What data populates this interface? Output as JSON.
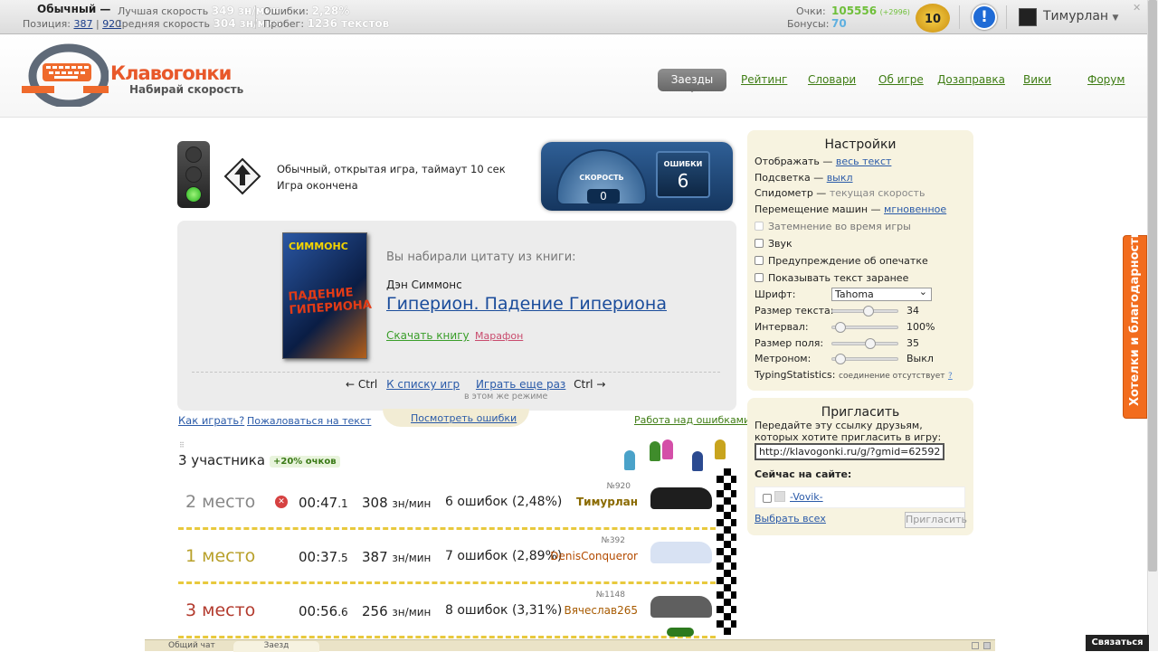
{
  "topbar": {
    "mode": "Обычный —",
    "position_label": "Позиция:",
    "position_a": "387",
    "position_sep": "|",
    "position_b": "920",
    "best_speed_label": "Лучшая скорость",
    "best_speed": "349 зн/мин",
    "avg_speed_label": "Средняя скорость",
    "avg_speed": "304 зн/мин",
    "errors_label": "Ошибки:",
    "errors": "2,28%",
    "mileage_label": "Пробег:",
    "mileage": "1236 текстов",
    "points_label": "Очки:",
    "points": "105556",
    "points_delta": "(+2996)",
    "bonus_label": "Бонусы:",
    "bonus": "70",
    "level": "10",
    "notif": "!",
    "username": "Тимурлан",
    "close": "✕"
  },
  "header": {
    "brand": "Клавогонки",
    "slogan": "Набирай скорость",
    "nav": [
      {
        "label": "Заезды"
      },
      {
        "label": "Рейтинг"
      },
      {
        "label": "Словари"
      },
      {
        "label": "Об игре"
      },
      {
        "label": "Дозаправка"
      },
      {
        "label": "Вики"
      },
      {
        "label": "Форум"
      }
    ]
  },
  "game": {
    "type_line": "Обычный, открытая игра, таймаут 10 сек",
    "status_line": "Игра окончена",
    "speed_label": "СКОРОСТЬ",
    "speed_value": "0",
    "errors_label": "ОШИБКИ",
    "errors_value": "6"
  },
  "book": {
    "cover_author": "СИММОНС",
    "cover_title": "ПАДЕНИЕ ГИПЕРИОНА",
    "label": "Вы набирали цитату из книги:",
    "author": "Дэн Симмонс",
    "title": "Гиперион. Падение Гипериона",
    "download": "Скачать книгу",
    "marathon": "Марафон",
    "ctrl_left": "← Ctrl",
    "to_list": "К списку игр",
    "play_again": "Играть еще раз",
    "play_again_sub": "в этом же режиме",
    "ctrl_right": "Ctrl →"
  },
  "links": {
    "how_to_play": "Как играть?",
    "complain": "Пожаловаться на текст",
    "view_errors": "Посмотреть ошибки",
    "work_errors": "Работа над ошибками"
  },
  "race": {
    "participants": "3 участника",
    "bonus": "+20% очков",
    "rows": [
      {
        "place": "2 место",
        "time": "00:47",
        "time_ms": ".1",
        "speed": "308",
        "speed_unit": "зн/мин",
        "errors": "6 ошибок (2,48%)",
        "rank": "№920",
        "name": "Тимурлан",
        "place_color": "#888888",
        "name_color": "#8a6a00",
        "car_color": "#1e1e1e"
      },
      {
        "place": "1 место",
        "time": "00:37",
        "time_ms": ".5",
        "speed": "387",
        "speed_unit": "зн/мин",
        "errors": "7 ошибок (2,89%)",
        "rank": "№392",
        "name": "DenisConqueror",
        "place_color": "#b8a02a",
        "name_color": "#b34b00",
        "car_color": "#c8d6ee"
      },
      {
        "place": "3 место",
        "time": "00:56",
        "time_ms": ".6",
        "speed": "256",
        "speed_unit": "зн/мин",
        "errors": "8 ошибок (3,31%)",
        "rank": "№1148",
        "name": "Вячеслав265",
        "place_color": "#b33b2e",
        "name_color": "#a75a00",
        "car_color": "#5f5f5f"
      }
    ]
  },
  "settings": {
    "title": "Настройки",
    "display_label": "Отображать —",
    "display_value": "весь текст",
    "highlight_label": "Подсветка —",
    "highlight_value": "выкл",
    "speedometer_label": "Спидометр —",
    "speedometer_value": "текущая скорость",
    "cars_label": "Перемещение машин —",
    "cars_value": "мгновенное",
    "dim": "Затемнение во время игры",
    "sound": "Звук",
    "typo_warn": "Предупреждение об опечатке",
    "show_text": "Показывать текст заранее",
    "font_label": "Шрифт:",
    "font_value": "Tahoma",
    "text_size_label": "Размер текста:",
    "text_size_value": "34",
    "text_size_level": 0.55,
    "interval_label": "Интервал:",
    "interval_value": "100%",
    "interval_level": 0.05,
    "field_size_label": "Размер поля:",
    "field_size_value": "35",
    "field_size_level": 0.58,
    "metronome_label": "Метроном:",
    "metronome_value": "Выкл",
    "metronome_level": 0.05,
    "typingstats_label": "TypingStatistics:",
    "typingstats_value": "соединение отсутствует",
    "typingstats_help": "?"
  },
  "invite": {
    "title": "Пригласить",
    "text": "Передайте эту ссылку друзьям, которых хотите пригласить в игру:",
    "url": "http://klavogonki.ru/g/?gmid=62592",
    "online_title": "Сейчас на сайте:",
    "online_user": "-Vovik-",
    "select_all": "Выбрать всех",
    "invite_button": "Пригласить"
  },
  "side_tab": "Хотелки и благодарности",
  "bottom": {
    "tab1": "Общий чат",
    "tab2": "Заезд",
    "contact": "Связаться"
  }
}
